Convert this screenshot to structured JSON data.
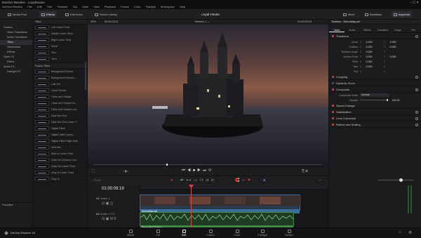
{
  "window": {
    "title": "DaVinci Resolve - LoyalHouse"
  },
  "menu": [
    "DaVinci Resolve",
    "File",
    "Edit",
    "Trim",
    "Timeline",
    "Clip",
    "Mark",
    "View",
    "Playback",
    "Fusion",
    "Color",
    "Fairlight",
    "Workspace",
    "Help"
  ],
  "toolbar": {
    "media_pool": "Media Pool",
    "effects": "Effects",
    "edit_index": "Edit Index",
    "sound_library": "Sound Library",
    "project_title": "Loyal House",
    "mixer": "Mixer",
    "metadata": "Metadata",
    "inspector": "Inspector"
  },
  "sidebar": {
    "items": [
      "Toolbox",
      "Video Transitions",
      "Audio Transitions",
      "Titles",
      "Generators",
      "Effects",
      "Open FX",
      "Filters",
      "Audio FX",
      "Fairlight FX",
      "Favorites"
    ],
    "selected": "Titles",
    "favorites_label": "Favorites"
  },
  "titles_panel": {
    "header": "Titles",
    "titles": [
      "Left Lower Third",
      "Middle Lower Third",
      "Right Lower Third",
      "Scroll",
      "Text",
      "Text+"
    ],
    "fusion_header": "Fusion Titles",
    "fusion_titles": [
      "Background Reveal",
      "Background Reveal L...",
      "Call Out",
      "Circle Reveal",
      "Clean and Simple",
      "Clean and Simple He...",
      "Clean and Simple Low...",
      "Dark Box Text",
      "Dark Box Text Lower T...",
      "Digital Glitch",
      "Digital Glitch Lower...",
      "Digital Glitch Right Side",
      "Dive Bar",
      "Dive In Lower Third",
      "Draw On Corners Low...",
      "Draw On Lower Third",
      "Drop In Lower Third",
      "Drop In"
    ]
  },
  "viewer": {
    "zoom": "29%",
    "timecode_left": "00:00:03:11",
    "timeline_name": "Timeline 1",
    "timecode_right": "01:00:09:19"
  },
  "inspector": {
    "clip_name": "Timeline - DemoMap.avi",
    "tabs": [
      "Video",
      "Audio",
      "Effects",
      "Transition",
      "Image",
      "File"
    ],
    "sections": {
      "transform": "Transform",
      "cropping": "Cropping",
      "dynamic_zoom": "Dynamic Zoom",
      "composite": "Composite",
      "speed_change": "Speed Change",
      "stabilization": "Stabilization",
      "lens_correction": "Lens Correction",
      "retime_scaling": "Retime and Scaling"
    },
    "params": [
      {
        "label": "Zoom",
        "x": "1.000",
        "y": "1.000"
      },
      {
        "label": "Position",
        "x": "0.000",
        "y": "0.000"
      },
      {
        "label": "Rotation Angle",
        "x": "0.000",
        "y": ""
      },
      {
        "label": "Anchor Point",
        "x": "0.000",
        "y": "0.000"
      },
      {
        "label": "Pitch",
        "x": "0.000",
        "y": ""
      },
      {
        "label": "Yaw",
        "x": "0.000",
        "y": ""
      },
      {
        "label": "Flip",
        "x": "",
        "y": ""
      }
    ],
    "composite_mode_label": "Composite Mode",
    "composite_mode_value": "Normal",
    "opacity_label": "Opacity",
    "opacity_value": "100.00"
  },
  "timeline": {
    "timecode": "01:00:09:19",
    "video_track": "V1",
    "video_track_name": "Video 1",
    "audio_track": "A1",
    "audio_track_name": "Audio 1",
    "audio_channels": "2.0",
    "video_clip": "DemoMap.avi",
    "audio_clip": "Recording 23.flac"
  },
  "brand": "DaVinci Resolve 16",
  "pages": [
    "Media",
    "Cut",
    "Edit",
    "Fusion",
    "Color",
    "Fairlight",
    "Deliver"
  ],
  "active_page": "Edit",
  "colors": {
    "accent_red": "#e0443d",
    "video_clip": "#3e6e9e",
    "audio_clip": "#3f8a48",
    "bg": "#1b1b1d"
  }
}
